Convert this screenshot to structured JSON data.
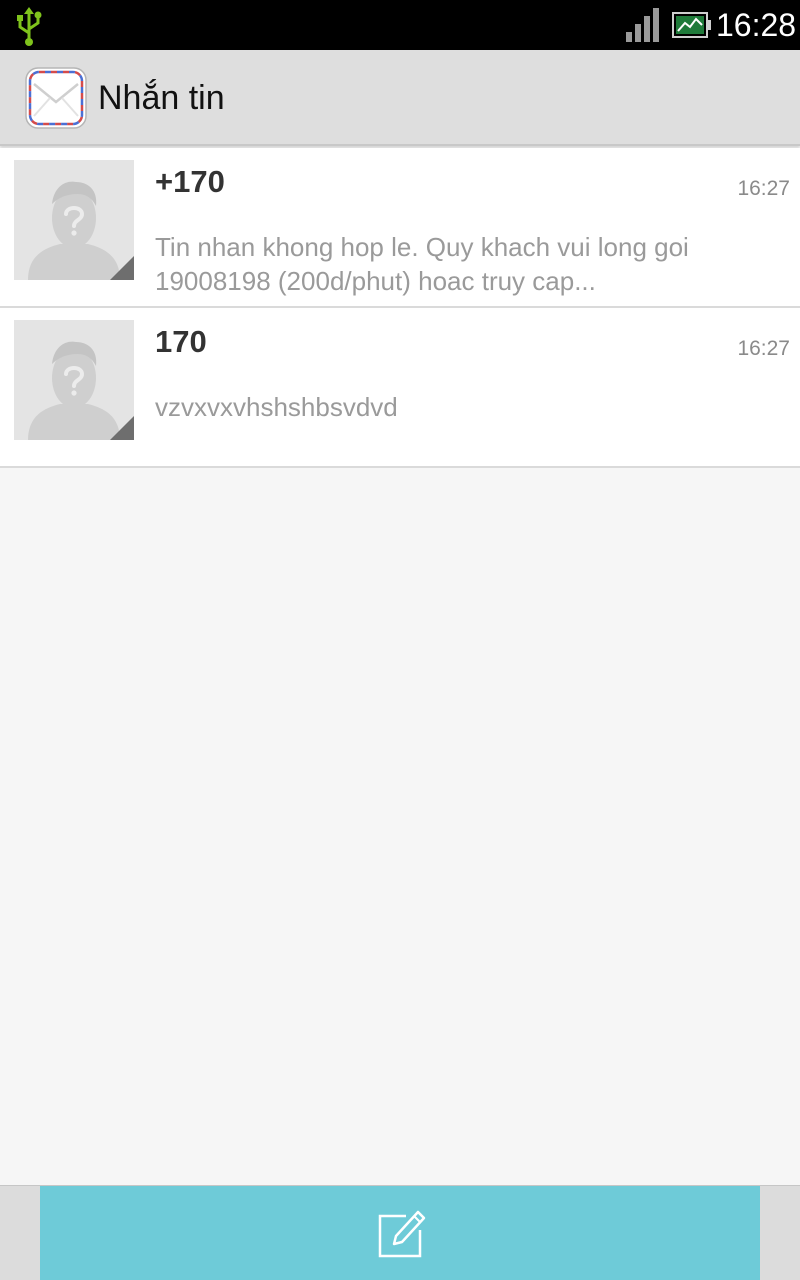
{
  "status_bar": {
    "time": "16:28",
    "icons": [
      "usb-icon",
      "signal-icon",
      "battery-icon"
    ]
  },
  "action_bar": {
    "title": "Nhắn tin",
    "icon": "envelope-icon"
  },
  "conversations": [
    {
      "name": "+170",
      "time": "16:27",
      "snippet": "Tin nhan khong hop le. Quy khach vui long goi 19008198 (200d/phut) hoac truy cap..."
    },
    {
      "name": "170",
      "time": "16:27",
      "snippet": "vzvxvxvhshshbsvdvd"
    }
  ],
  "bottom_bar": {
    "compose_icon": "compose-icon"
  },
  "colors": {
    "usb": "#7fc31c",
    "accent": "#6ecbd8",
    "action_bar": "#dedede"
  }
}
